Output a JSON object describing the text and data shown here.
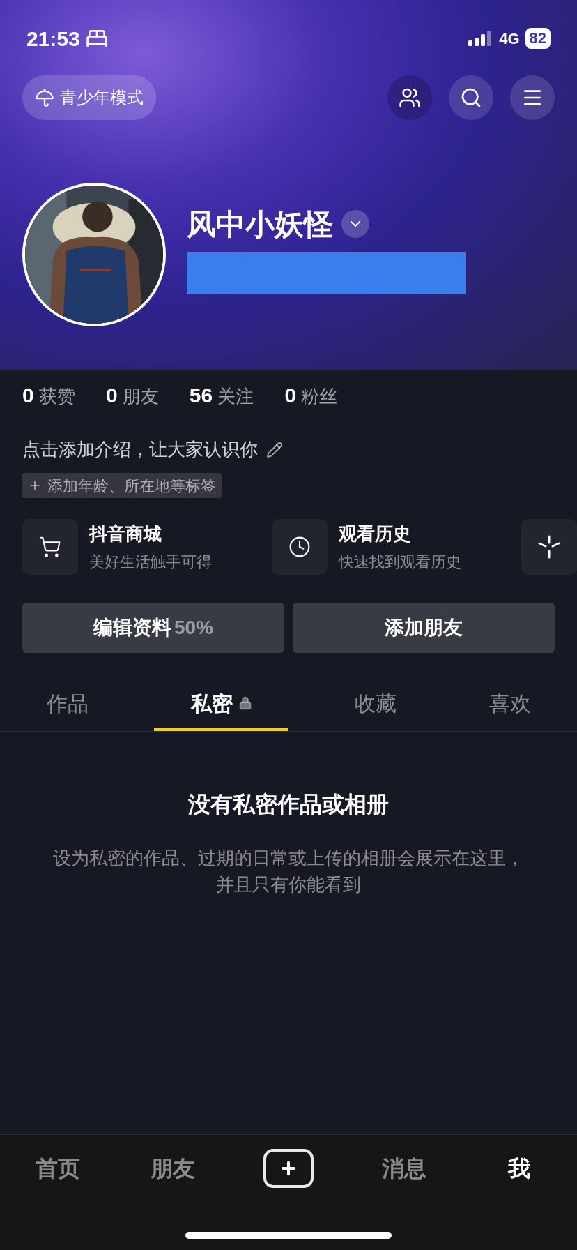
{
  "status_bar": {
    "time": "21:53",
    "network": "4G",
    "battery": "82"
  },
  "header": {
    "teen_mode": "青少年模式"
  },
  "profile": {
    "name": "风中小妖怪"
  },
  "stats": [
    "**0** 获赞",
    "**0** 朋友",
    "**56** 关注",
    "**0** 粉丝"
  ],
  "bio": "点击添加介绍，让大家认识你",
  "tag": "添加年龄、所在地等标签",
  "shortcuts": [
    {
      "kind": "cart",
      "title": "抖音商城",
      "subtitle": "美好生活触手可得"
    },
    {
      "kind": "history",
      "title": "观看历史",
      "subtitle": "快速找到观看历史"
    },
    {
      "kind": "more"
    }
  ],
  "buttons": {
    "edit": {
      "label": "编辑资料",
      "progress": "50%"
    },
    "add_friend": "添加朋友"
  },
  "tabs": [
    {
      "label": "作品",
      "selected": false,
      "locked": false
    },
    {
      "label": "私密",
      "selected": true,
      "locked": true
    },
    {
      "label": "收藏",
      "selected": false,
      "locked": false
    },
    {
      "label": "喜欢",
      "selected": false,
      "locked": false
    }
  ],
  "empty_state": {
    "title": "没有私密作品或相册",
    "description": "设为私密的作品、过期的日常或上传的相册会展示在这里，并且只有你能看到"
  },
  "bottom_nav": [
    {
      "kind": "tab",
      "label": "首页",
      "selected": false
    },
    {
      "kind": "tab",
      "label": "朋友",
      "selected": false
    },
    {
      "kind": "create"
    },
    {
      "kind": "tab",
      "label": "消息",
      "selected": false
    },
    {
      "kind": "tab",
      "label": "我",
      "selected": true
    }
  ]
}
